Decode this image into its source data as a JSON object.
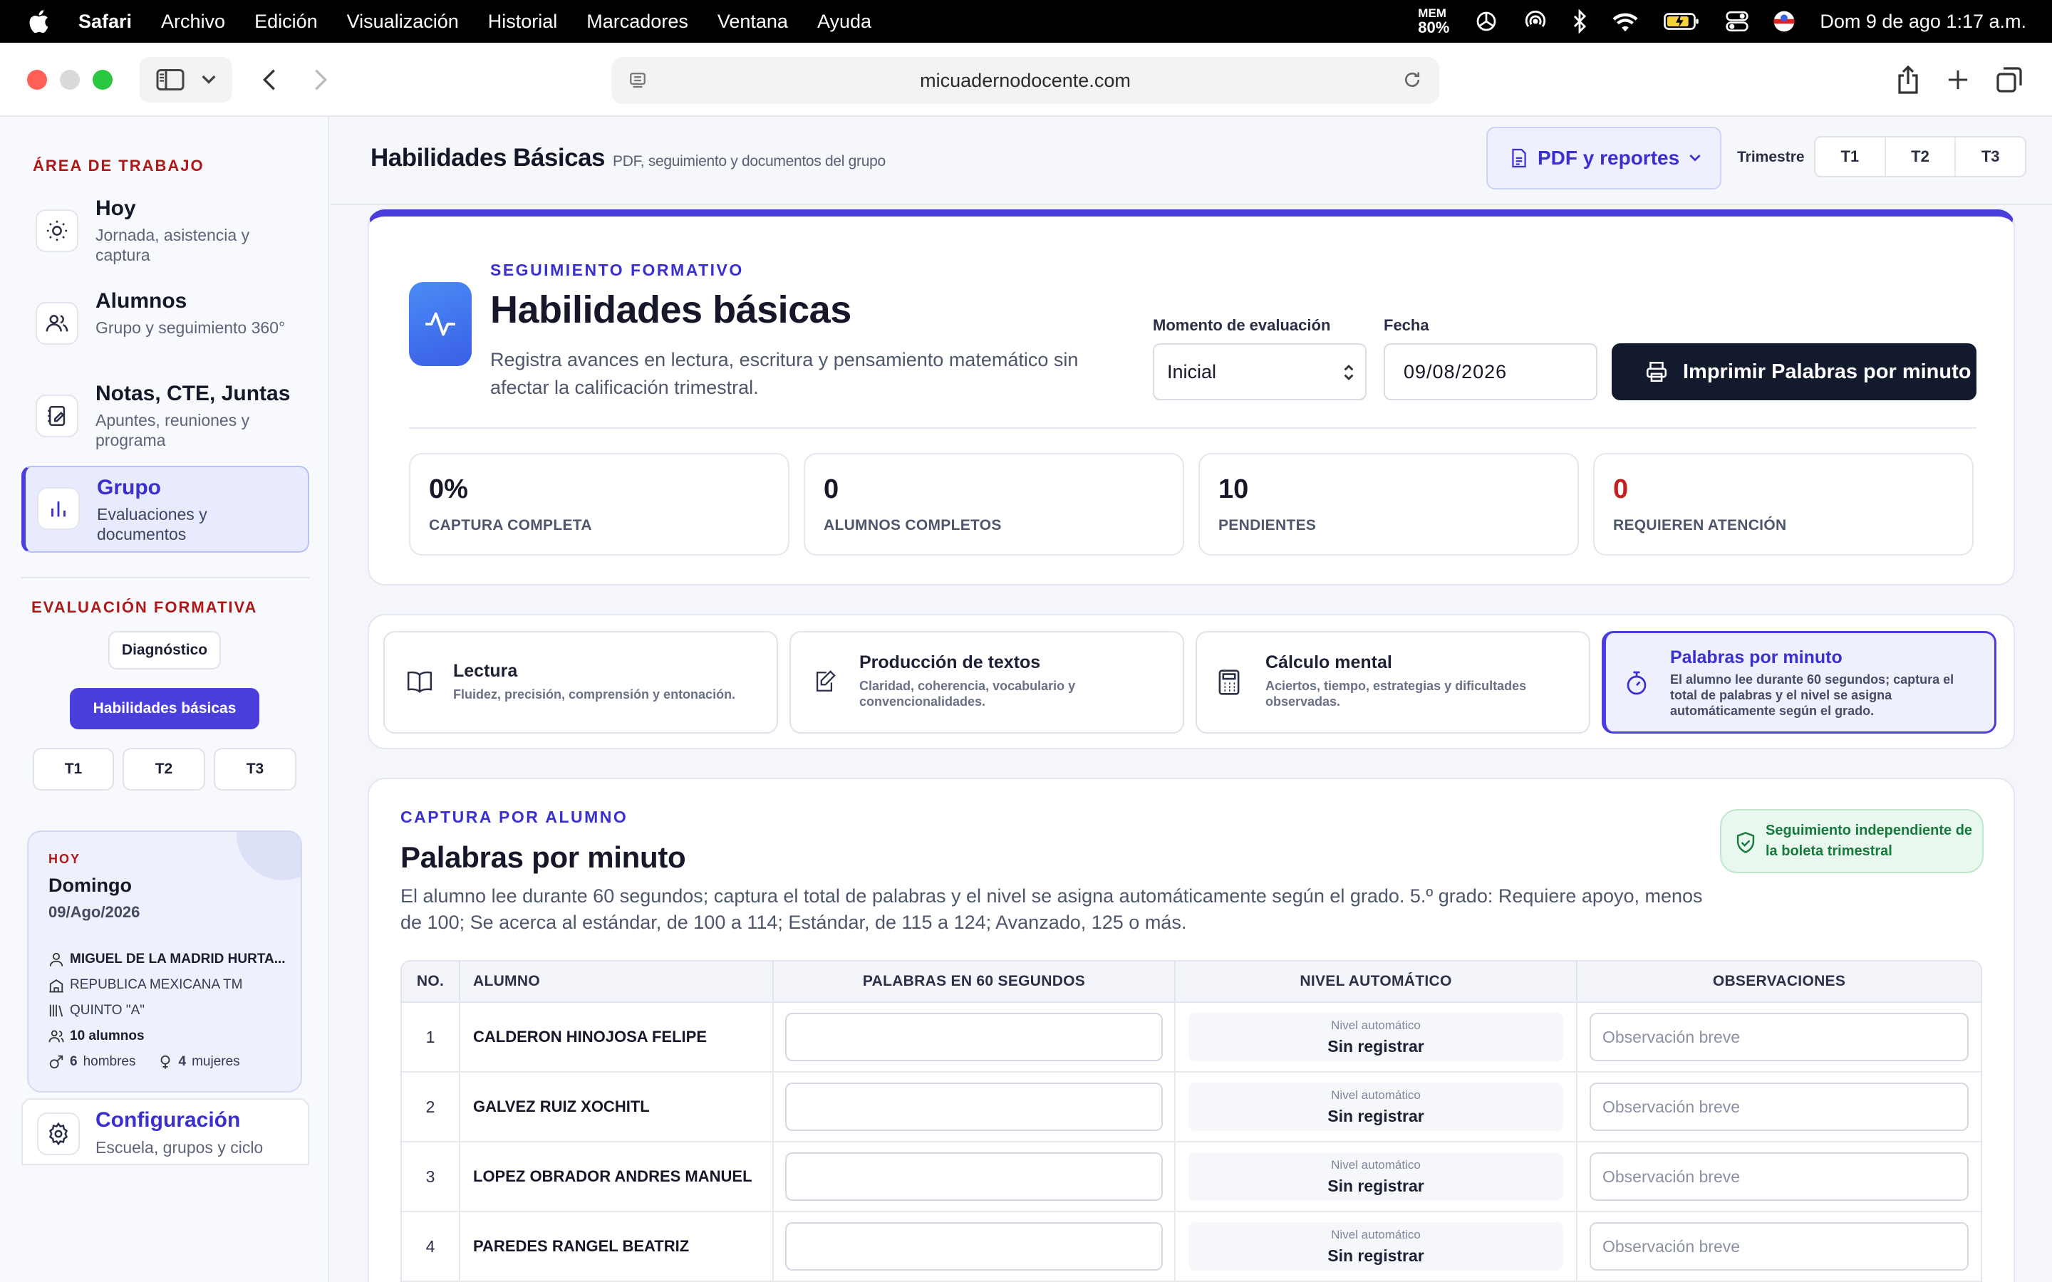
{
  "menubar": {
    "app": "Safari",
    "items": [
      "Archivo",
      "Edición",
      "Visualización",
      "Historial",
      "Marcadores",
      "Ventana",
      "Ayuda"
    ],
    "mem_label": "MEM",
    "mem_value": "80%",
    "clock": "Dom 9 de ago  1:17 a.m."
  },
  "browser": {
    "url": "micuadernodocente.com"
  },
  "sidebar": {
    "workspace_label": "ÁREA DE TRABAJO",
    "nav": [
      {
        "title": "Hoy",
        "sub": "Jornada, asistencia y captura",
        "icon": "sun-icon"
      },
      {
        "title": "Alumnos",
        "sub": "Grupo y seguimiento 360°",
        "icon": "users-icon"
      },
      {
        "title": "Notas, CTE, Juntas",
        "sub": "Apuntes, reuniones y programa",
        "icon": "notebook-icon"
      },
      {
        "title": "Grupo",
        "sub": "Evaluaciones y documentos",
        "icon": "bar-chart-icon"
      }
    ],
    "formative_label": "EVALUACIÓN FORMATIVA",
    "diagnostic_label": "Diagnóstico",
    "basic_skills_label": "Habilidades básicas",
    "terms": [
      "T1",
      "T2",
      "T3"
    ],
    "today": {
      "label": "HOY",
      "day": "Domingo",
      "date": "09/Ago/2026",
      "teacher": "MIGUEL DE LA MADRID HURTA...",
      "school": "REPUBLICA MEXICANA TM",
      "group": "QUINTO \"A\"",
      "students": "10 alumnos",
      "men_count": "6",
      "men_label": "hombres",
      "women_count": "4",
      "women_label": "mujeres"
    },
    "config": {
      "title": "Configuración",
      "sub": "Escuela, grupos y ciclo"
    }
  },
  "header": {
    "title": "Habilidades Básicas",
    "subtitle": "PDF, seguimiento y documentos del grupo",
    "pdf_button": "PDF y reportes",
    "term_label": "Trimestre",
    "terms": [
      "T1",
      "T2",
      "T3"
    ]
  },
  "hero": {
    "kicker": "SEGUIMIENTO FORMATIVO",
    "title": "Habilidades básicas",
    "description": "Registra avances en lectura, escritura y pensamiento matemático sin afectar la calificación trimestral.",
    "moment_label": "Momento de evaluación",
    "moment_value": "Inicial",
    "date_label": "Fecha",
    "date_value": "09/08/2026",
    "print_button": "Imprimir Palabras por minuto",
    "stats": [
      {
        "value": "0%",
        "label": "CAPTURA COMPLETA"
      },
      {
        "value": "0",
        "label": "ALUMNOS COMPLETOS"
      },
      {
        "value": "10",
        "label": "PENDIENTES"
      },
      {
        "value": "0",
        "label": "REQUIEREN ATENCIÓN"
      }
    ]
  },
  "skills": [
    {
      "title": "Lectura",
      "desc": "Fluidez, precisión, comprensión y entonación.",
      "icon": "book-icon"
    },
    {
      "title": "Producción de textos",
      "desc": "Claridad, coherencia, vocabulario y convencionalidades.",
      "icon": "edit-icon"
    },
    {
      "title": "Cálculo mental",
      "desc": "Aciertos, tiempo, estrategias y dificultades observadas.",
      "icon": "calculator-icon"
    },
    {
      "title": "Palabras por minuto",
      "desc": "El alumno lee durante 60 segundos; captura el total de palabras y el nivel se asigna automáticamente según el grado.",
      "icon": "stopwatch-icon"
    }
  ],
  "capture": {
    "kicker": "CAPTURA POR ALUMNO",
    "title": "Palabras por minuto",
    "description": "El alumno lee durante 60 segundos; captura el total de palabras y el nivel se asigna automáticamente según el grado. 5.º grado: Requiere apoyo, menos de 100; Se acerca al estándar, de 100 a 114; Estándar, de 115 a 124; Avanzado, 125 o más.",
    "badge": "Seguimiento independiente de la boleta trimestral",
    "columns": [
      "NO.",
      "ALUMNO",
      "PALABRAS EN 60 SEGUNDOS",
      "NIVEL AUTOMÁTICO",
      "OBSERVACIONES"
    ],
    "level_label": "Nivel automático",
    "level_value": "Sin registrar",
    "obs_placeholder": "Observación breve",
    "rows": [
      {
        "no": "1",
        "name": "CALDERON HINOJOSA FELIPE"
      },
      {
        "no": "2",
        "name": "GALVEZ RUIZ XOCHITL"
      },
      {
        "no": "3",
        "name": "LOPEZ OBRADOR ANDRES MANUEL"
      },
      {
        "no": "4",
        "name": "PAREDES RANGEL BEATRIZ"
      }
    ]
  },
  "colors": {
    "accent": "#4a3fdc",
    "dark_button": "#141a2e",
    "alert_red": "#c41f1f",
    "section_red": "#b01818",
    "success_green": "#157a3b"
  }
}
